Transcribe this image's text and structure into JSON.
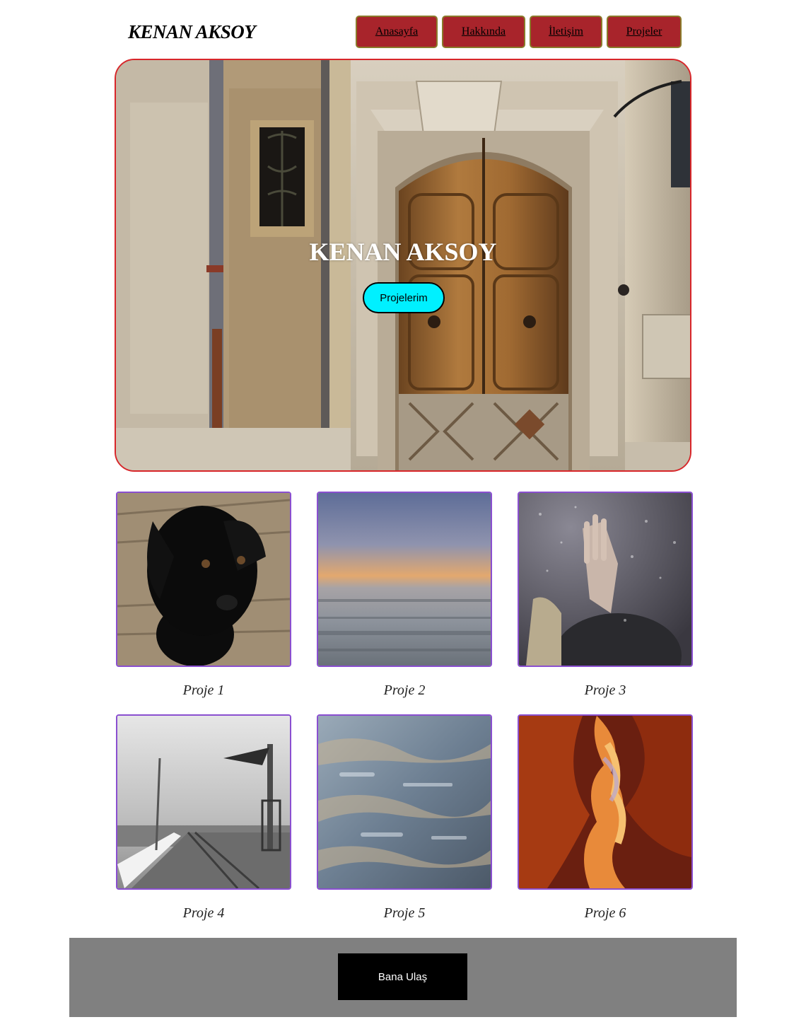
{
  "header": {
    "logo": "KENAN AKSOY",
    "nav": [
      {
        "label": "Anasayfa"
      },
      {
        "label": "Hakkında"
      },
      {
        "label": "İletişim"
      },
      {
        "label": "Projeler"
      }
    ]
  },
  "hero": {
    "title": "KENAN AKSOY",
    "button_label": "Projelerim"
  },
  "gallery": {
    "projects": [
      {
        "caption": "Proje 1",
        "image": "black-puppy-photo"
      },
      {
        "caption": "Proje 2",
        "image": "sunset-sea-photo"
      },
      {
        "caption": "Proje 3",
        "image": "hand-on-rainy-glass-photo"
      },
      {
        "caption": "Proje 4",
        "image": "pier-lighthouse-photo"
      },
      {
        "caption": "Proje 5",
        "image": "water-reflection-photo"
      },
      {
        "caption": "Proje 6",
        "image": "canyon-photo"
      }
    ]
  },
  "footer": {
    "button_label": "Bana Ulaş"
  },
  "colors": {
    "nav_bg": "#a8242b",
    "hero_border": "#d8262a",
    "hero_button": "#00f0ff",
    "thumb_border": "#8a4fd0",
    "footer_bg": "#808080",
    "footer_button": "#000000"
  }
}
